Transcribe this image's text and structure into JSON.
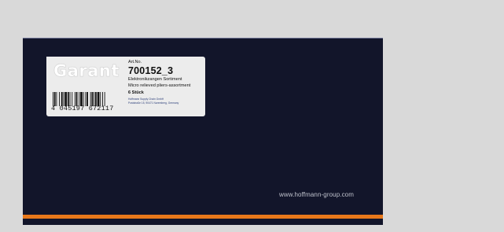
{
  "colors": {
    "background": "#d9d9d9",
    "box": "#12152a",
    "accent_stripe": "#e8781b",
    "label": "#ececec"
  },
  "label": {
    "brand": "Garant",
    "art_no_label": "Art.No.",
    "art_no": "700152_3",
    "description_de": "Elektronikzangen Sortiment",
    "description_en": "Micro relieved pliers-assortment",
    "quantity": "6 Stück",
    "address_line1": "Hoffmann Supply Chain GmbH",
    "address_line2": "Poststraße 15, 90471 Nuremberg, Germany",
    "barcode_number": "4 045197 672117"
  },
  "box": {
    "website": "www.hoffmann-group.com"
  }
}
